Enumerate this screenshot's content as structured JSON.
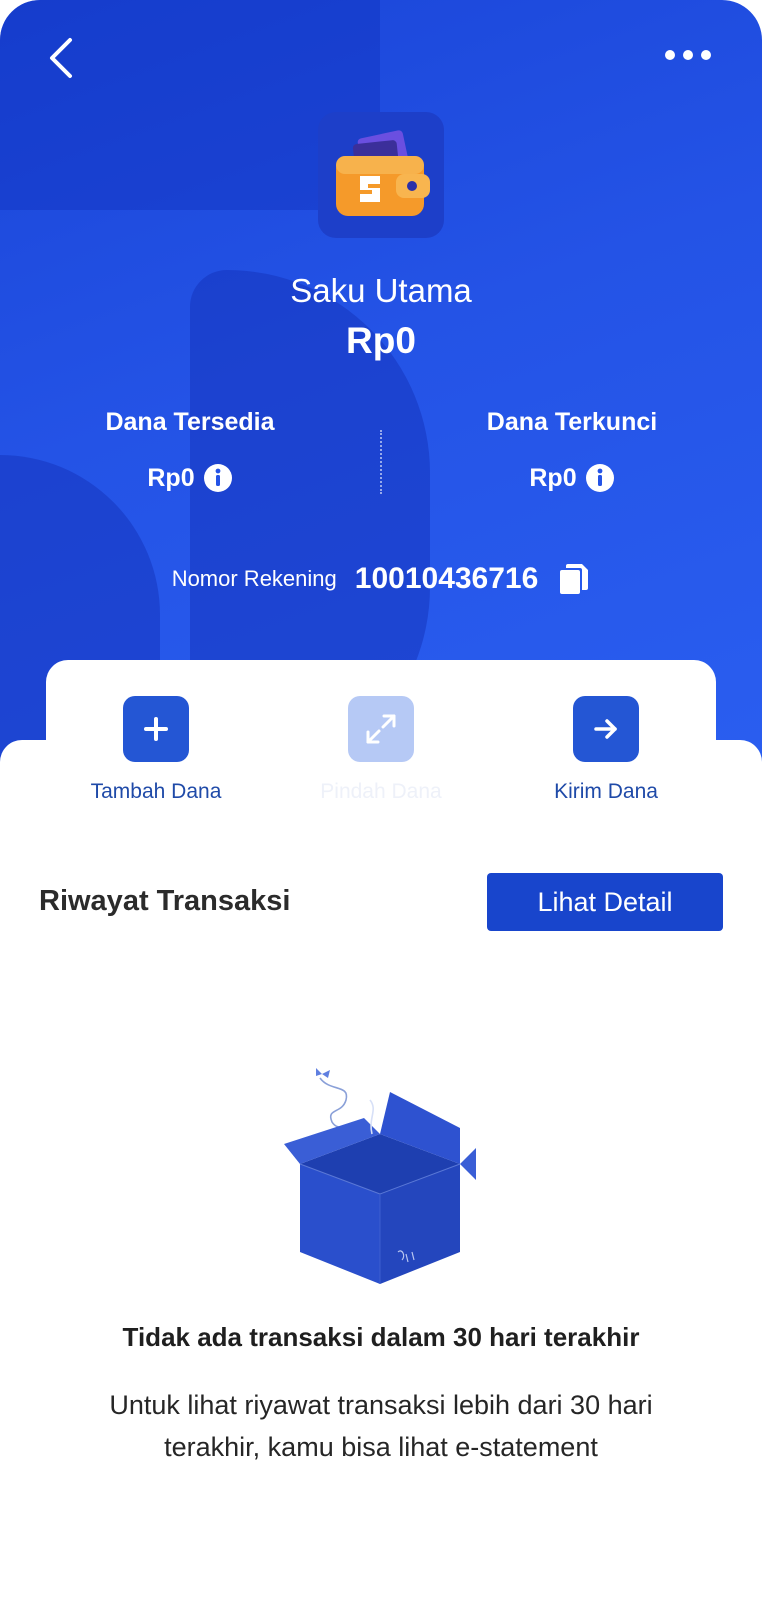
{
  "header": {
    "back_icon": "chevron-left-icon",
    "more_icon": "more-horizontal-icon"
  },
  "pocket": {
    "icon": "wallet-icon",
    "name": "Saku Utama",
    "balance": "Rp0"
  },
  "funds": {
    "available_label": "Dana Tersedia",
    "available_value": "Rp0",
    "locked_label": "Dana Terkunci",
    "locked_value": "Rp0",
    "info_icon": "info-icon"
  },
  "account": {
    "label": "Nomor Rekening",
    "number": "10010436716",
    "copy_icon": "copy-icon"
  },
  "actions": [
    {
      "label": "Tambah Dana",
      "icon": "plus-icon",
      "enabled": true
    },
    {
      "label": "Pindah Dana",
      "icon": "transfer-arrows-icon",
      "enabled": false
    },
    {
      "label": "Kirim Dana",
      "icon": "arrow-right-icon",
      "enabled": true
    }
  ],
  "history": {
    "title": "Riwayat Transaksi",
    "detail_button": "Lihat Detail"
  },
  "empty_state": {
    "illustration": "open-box-illustration",
    "title": "Tidak ada transaksi dalam 30 hari terakhir",
    "description": "Untuk lihat riyawat transaksi lebih dari 30 hari terakhir, kamu bisa lihat e-statement"
  },
  "colors": {
    "brand_blue": "#1845cc",
    "hero_blue": "#2453e6",
    "action_label": "#1f4aa8"
  }
}
